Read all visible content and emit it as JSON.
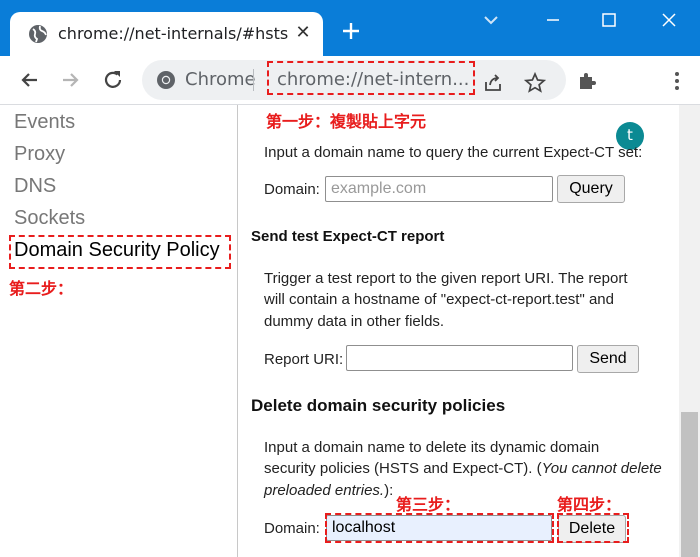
{
  "tab": {
    "title": "chrome://net-internals/#hsts"
  },
  "omnibox": {
    "site_label": "Chrome",
    "url": "chrome://net-intern..."
  },
  "profile": {
    "initial": "t"
  },
  "sidebar": {
    "items": [
      "Events",
      "Proxy",
      "DNS",
      "Sockets"
    ],
    "active_item": "Domain Security Policy"
  },
  "annotations": {
    "step1": "第一步：複製貼上字元",
    "step2": "第二步：",
    "step3": "第三步：",
    "step4": "第四步："
  },
  "query_section": {
    "description": "Input a domain name to query the current Expect-CT set:",
    "domain_label": "Domain:",
    "domain_placeholder": "example.com",
    "query_button": "Query"
  },
  "test_report_section": {
    "heading": "Send test Expect-CT report",
    "description_lines": [
      "Trigger a test report to the given report URI. The report",
      "will contain a hostname of \"expect-ct-report.test\" and",
      "dummy data in other fields."
    ],
    "uri_label": "Report URI:",
    "send_button": "Send"
  },
  "delete_section": {
    "heading": "Delete domain security policies",
    "description_line1": "Input a domain name to delete its dynamic domain",
    "description_line2_plain": "security policies (HSTS and Expect-CT). (",
    "description_line2_italic": "You cannot delete",
    "description_line3_italic": "preloaded entries.",
    "description_line3_plain": "):",
    "domain_label": "Domain:",
    "domain_value": "localhost",
    "delete_button": "Delete"
  },
  "colors": {
    "titlebar": "#0a7dd8",
    "annotation": "#e81d1d",
    "avatar": "#0b8a93"
  }
}
